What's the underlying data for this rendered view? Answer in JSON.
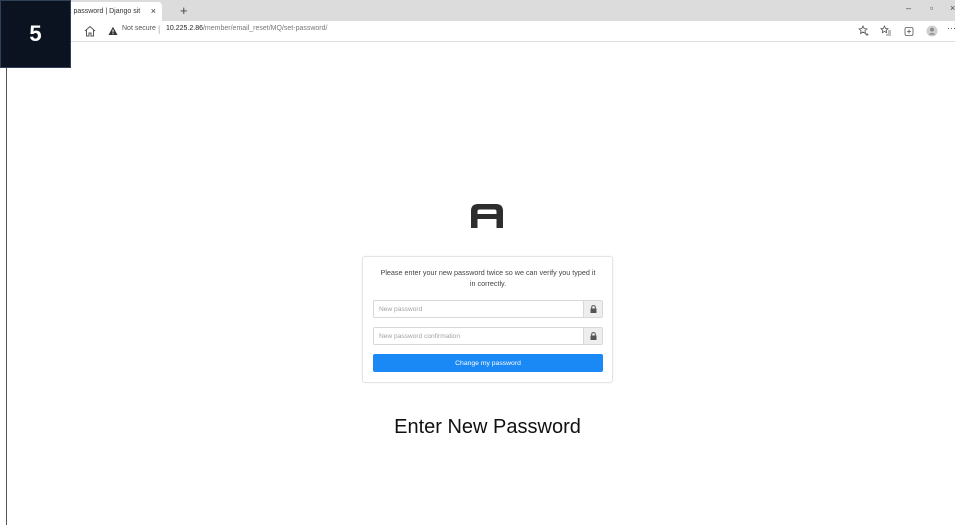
{
  "browser": {
    "tab_title": "x password | Django sit",
    "tab_close": "×",
    "new_tab": "+",
    "window_controls": {
      "minimize": "–",
      "restore": "▫",
      "close": "×"
    },
    "security_label": "Not secure",
    "separator": "|",
    "url_host": "10.225.2.86",
    "url_path": "/member/email_reset/MQ/set-password/",
    "menu_dots": "···"
  },
  "step_badge": "5",
  "form": {
    "instructions": "Please enter your new password twice so we can verify you typed it in correctly.",
    "new_password_placeholder": "New password",
    "confirm_password_placeholder": "New password confirmation",
    "submit_label": "Change my password"
  },
  "caption": "Enter New Password",
  "colors": {
    "primary_button": "#1a88f5",
    "badge_bg": "#0b1220"
  },
  "icons": [
    "home-icon",
    "warning-icon",
    "lock-icon",
    "star-add-icon",
    "favorites-icon",
    "collections-icon",
    "profile-icon",
    "logo-a-icon"
  ]
}
